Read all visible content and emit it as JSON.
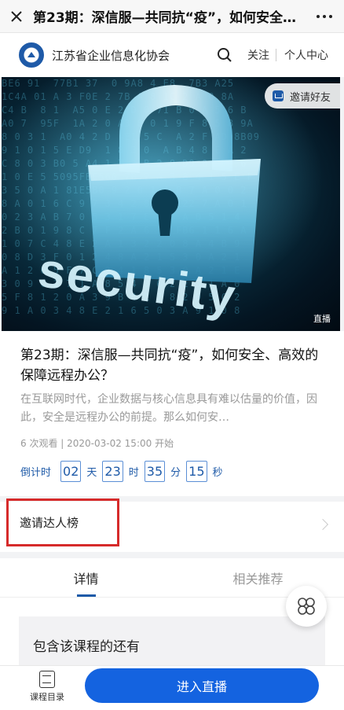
{
  "titlebar": {
    "title": "第23期：深信服—共同抗“疫”，如何安全、高效的保障远程办公？"
  },
  "org": {
    "name": "江苏省企业信息化协会",
    "follow": "关注",
    "personal_center": "个人中心"
  },
  "hero": {
    "invite": "邀请好友",
    "live_tag": "直播",
    "image_word": "security"
  },
  "course": {
    "title": "第23期：深信服—共同抗“疫”，如何安全、高效的保障远程办公？",
    "description": "在互联网时代，企业数据与核心信息具有难以估量的价值，因此，安全是远程办公的前提。那么如何安…",
    "meta": "6 次观看 | 2020-03-02 15:00 开始"
  },
  "countdown": {
    "label": "倒计时",
    "days": "02",
    "days_unit": "天",
    "hours": "23",
    "hours_unit": "时",
    "minutes": "35",
    "minutes_unit": "分",
    "seconds": "15",
    "seconds_unit": "秒"
  },
  "ranking": {
    "label": "邀请达人榜"
  },
  "tabs": [
    {
      "label": "详情"
    },
    {
      "label": "相关推荐"
    }
  ],
  "section": {
    "title": "包含该课程的还有"
  },
  "bottom": {
    "catalog": "课程目录",
    "enter": "进入直播"
  },
  "colors": {
    "accent": "#1463e0",
    "highlight_box": "#d62b2b"
  }
}
